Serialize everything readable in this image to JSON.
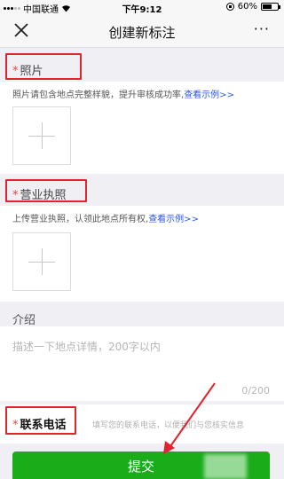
{
  "status_bar": {
    "carrier": "中国联通",
    "time": "下午9:12",
    "battery_text": "60%",
    "battery_level": 0.6
  },
  "nav": {
    "title": "创建新标注",
    "more": "···"
  },
  "photo": {
    "star": "*",
    "label": "照片",
    "hint": "照片请包含地点完整样貌，提升审核成功率,",
    "link": "查看示例>>"
  },
  "license": {
    "star": "*",
    "label": "营业执照",
    "hint": "上传营业执照，认领此地点所有权,",
    "link": "查看示例>>"
  },
  "intro": {
    "label": "介绍",
    "placeholder": "描述一下地点详情，200字以内",
    "counter": "0/200"
  },
  "phone": {
    "star": "*",
    "label": "联系电话",
    "hint": "填写您的联系电话，以便我们与您核实信息"
  },
  "submit_label": "提交",
  "colors": {
    "accent_green": "#1aad19",
    "link_blue": "#2e59d9",
    "annotation_red": "#e0242d"
  }
}
